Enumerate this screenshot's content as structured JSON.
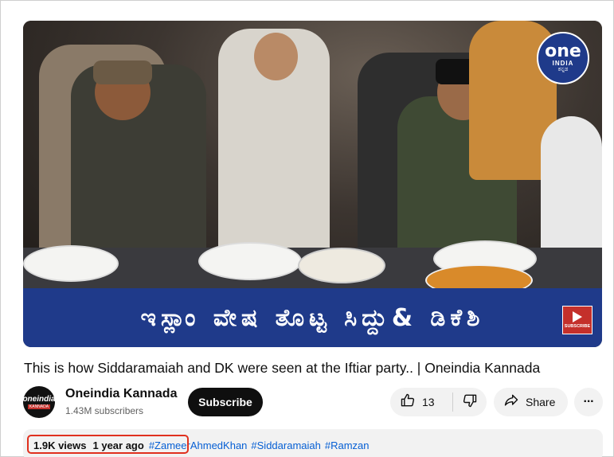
{
  "video": {
    "overlay_caption": "ಇಸ್ಲಾಂ ವೇಷ ತೊಟ್ಟ ಸಿದ್ದು& ಡಿಕೆಶಿ",
    "channel_bug": {
      "line1": "one",
      "line2": "INDIA",
      "line3": "ಕನ್ನಡ"
    },
    "subscribe_bug_label": "SUBSCRIBE"
  },
  "title": "This is how Siddaramaiah and DK were seen at the Iftiar party.. | Oneindia Kannada",
  "channel": {
    "avatar_line1": "oneindia",
    "avatar_line2": "KANNADA",
    "name": "Oneindia Kannada",
    "subscribers": "1.43M subscribers",
    "subscribe_label": "Subscribe"
  },
  "actions": {
    "like_count": "13",
    "share_label": "Share",
    "more_label": "···"
  },
  "description": {
    "views": "1.9K views",
    "age": "1 year ago",
    "hashtags": [
      "#ZameerAhmedKhan",
      "#Siddaramaiah",
      "#Ramzan"
    ]
  },
  "colors": {
    "caption_band": "#1f3a8a",
    "subscribe_button": "#0f0f0f",
    "hashtag": "#065fd4",
    "highlight_box": "#e0301e"
  },
  "icons": [
    "thumbs-up-icon",
    "thumbs-down-icon",
    "share-icon",
    "more-icon"
  ]
}
